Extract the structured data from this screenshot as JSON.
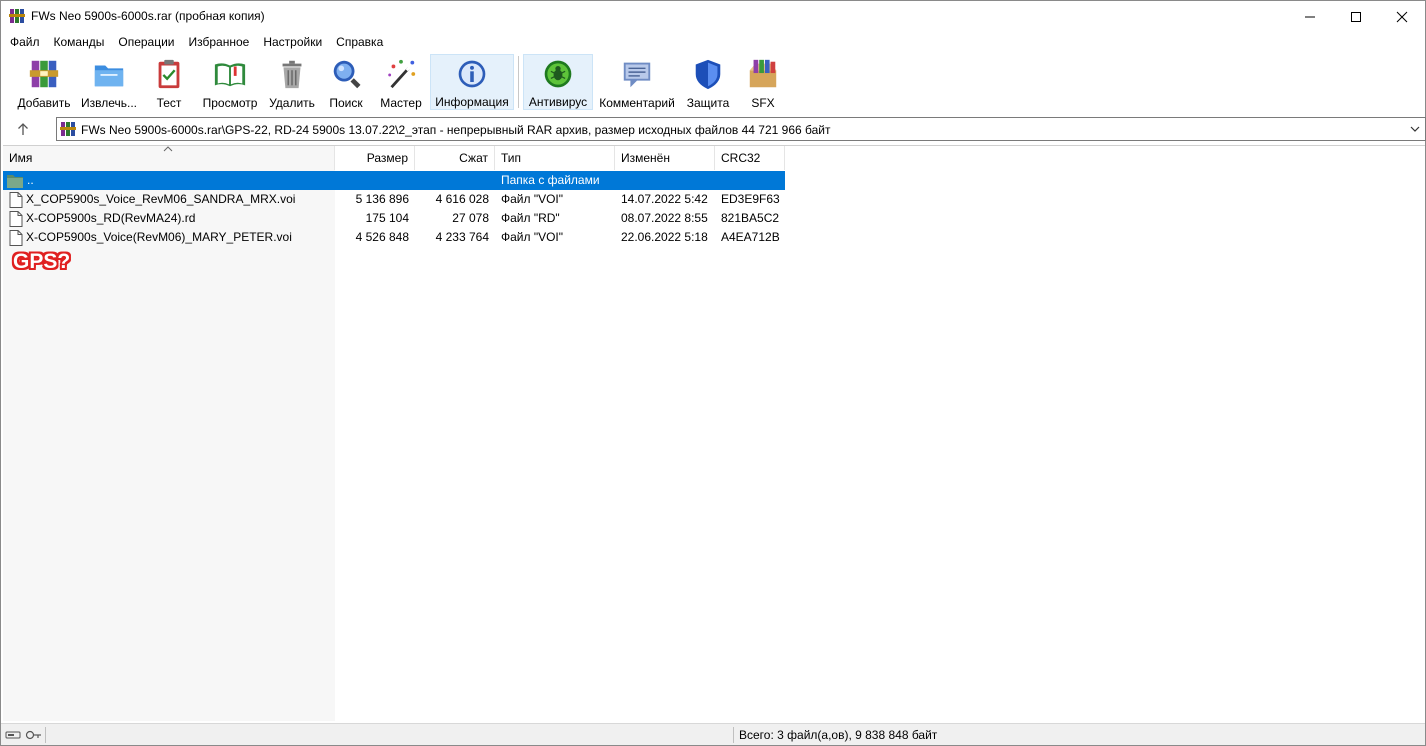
{
  "window": {
    "title": "FWs Neo 5900s-6000s.rar (пробная копия)"
  },
  "menu": [
    "Файл",
    "Команды",
    "Операции",
    "Избранное",
    "Настройки",
    "Справка"
  ],
  "toolbar": {
    "add": "Добавить",
    "extract": "Извлечь...",
    "test": "Тест",
    "view": "Просмотр",
    "delete": "Удалить",
    "find": "Поиск",
    "wizard": "Мастер",
    "info": "Информация",
    "antivirus": "Антивирус",
    "comment": "Комментарий",
    "protect": "Защита",
    "sfx": "SFX"
  },
  "address": {
    "path": "FWs Neo 5900s-6000s.rar\\GPS-22, RD-24 5900s 13.07.22\\2_этап - непрерывный RAR архив, размер исходных файлов 44 721 966 байт"
  },
  "columns": {
    "name": "Имя",
    "size": "Размер",
    "packed": "Сжат",
    "type": "Тип",
    "modified": "Изменён",
    "crc": "CRC32"
  },
  "rows": [
    {
      "name": "..",
      "size": "",
      "packed": "",
      "type": "Папка с файлами",
      "modified": "",
      "crc": "",
      "icon": "folder-icon"
    },
    {
      "name": "X_COP5900s_Voice_RevM06_SANDRA_MRX.voi",
      "size": "5 136 896",
      "packed": "4 616 028",
      "type": "Файл \"VOI\"",
      "modified": "14.07.2022 5:42",
      "crc": "ED3E9F63",
      "icon": "file-icon"
    },
    {
      "name": "X-COP5900s_RD(RevMA24).rd",
      "size": "175 104",
      "packed": "27 078",
      "type": "Файл \"RD\"",
      "modified": "08.07.2022 8:55",
      "crc": "821BA5C2",
      "icon": "file-icon"
    },
    {
      "name": "X-COP5900s_Voice(RevM06)_MARY_PETER.voi",
      "size": "4 526 848",
      "packed": "4 233 764",
      "type": "Файл \"VOI\"",
      "modified": "22.06.2022 5:18",
      "crc": "A4EA712B",
      "icon": "file-icon"
    }
  ],
  "annotation": "GPS?",
  "status": {
    "total": "Всего: 3 файл(а,ов), 9 838 848 байт"
  },
  "colors": {
    "selection": "#0078d7",
    "annotation_outline": "#e02020"
  }
}
